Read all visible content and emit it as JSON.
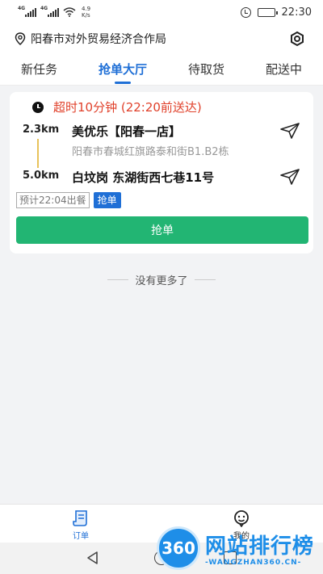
{
  "status_bar": {
    "signal1_tag": "4G",
    "signal2_tag": "4G",
    "net_speed_value": "4.9",
    "net_speed_unit": "K/s",
    "time": "22:30"
  },
  "header": {
    "location": "阳春市对外贸易经济合作局",
    "tabs": [
      {
        "label": "新任务",
        "active": false
      },
      {
        "label": "抢单大厅",
        "active": true
      },
      {
        "label": "待取货",
        "active": false
      },
      {
        "label": "配送中",
        "active": false
      }
    ]
  },
  "order": {
    "timeout_text": "超时10分钟 (22:20前送达)",
    "shop_distance": "2.3km",
    "shop_name": "美优乐【阳春一店】",
    "shop_address": "阳春市春城红旗路泰和街B1.B2栋",
    "dest_distance": "5.0km",
    "dest_name": "白坟岗 东湖街西七巷11号",
    "estimate_tag": "预计22:04出餐",
    "grab_tag": "抢单",
    "grab_button": "抢单"
  },
  "list_footer": "没有更多了",
  "bottom_nav": {
    "orders_label": "订单",
    "mine_label": "我的"
  },
  "watermark": {
    "badge": "360",
    "title": "网站排行榜",
    "subtitle": "-WANGZHAN360.CN-"
  },
  "colors": {
    "accent_blue": "#1f6fd6",
    "grab_green": "#22b573",
    "timeout_red": "#e0402a",
    "route_yellow": "#e8c25a"
  }
}
